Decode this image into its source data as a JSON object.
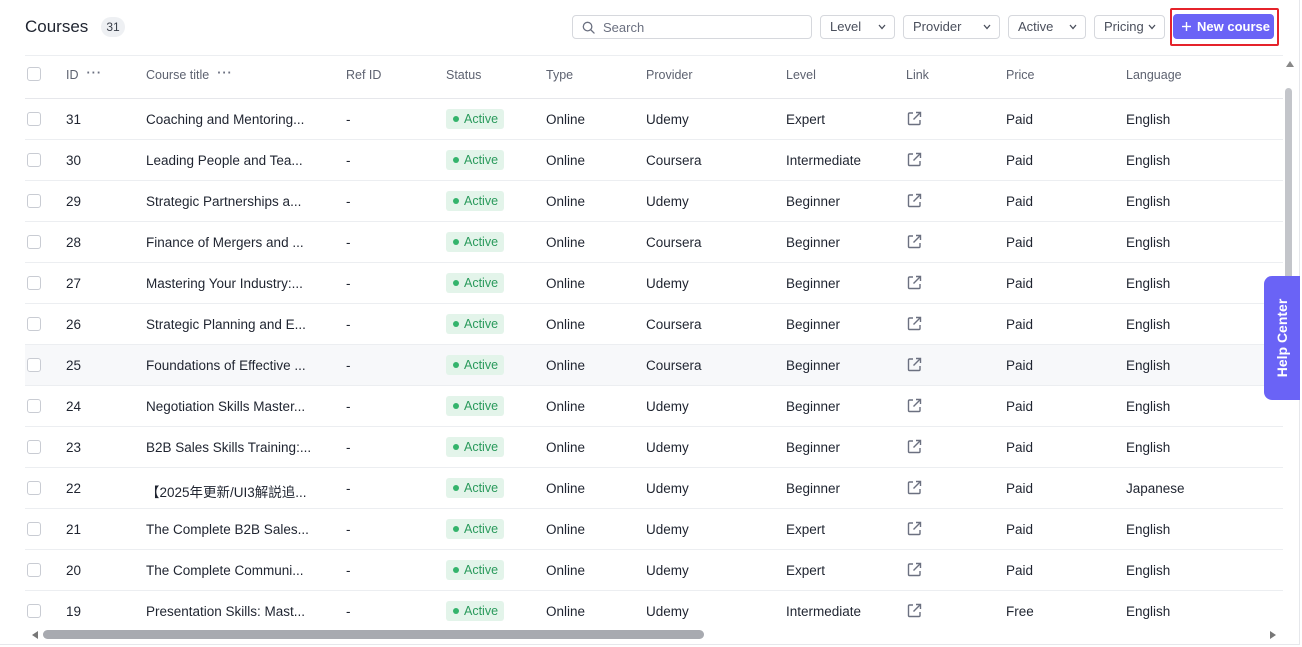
{
  "header": {
    "title": "Courses",
    "count": "31",
    "search_placeholder": "Search",
    "filters": [
      {
        "label": "Level"
      },
      {
        "label": "Provider"
      },
      {
        "label": "Active"
      },
      {
        "label": "Pricing"
      }
    ],
    "new_course_label": "New course"
  },
  "table": {
    "columns": {
      "id": "ID",
      "course_title": "Course title",
      "ref_id": "Ref ID",
      "status": "Status",
      "type": "Type",
      "provider": "Provider",
      "level": "Level",
      "link": "Link",
      "price": "Price",
      "language": "Language"
    },
    "rows": [
      {
        "id": "31",
        "title": "Coaching and Mentoring...",
        "ref": "-",
        "status": "Active",
        "type": "Online",
        "provider": "Udemy",
        "level": "Expert",
        "price": "Paid",
        "language": "English"
      },
      {
        "id": "30",
        "title": "Leading People and Tea...",
        "ref": "-",
        "status": "Active",
        "type": "Online",
        "provider": "Coursera",
        "level": "Intermediate",
        "price": "Paid",
        "language": "English"
      },
      {
        "id": "29",
        "title": "Strategic Partnerships a...",
        "ref": "-",
        "status": "Active",
        "type": "Online",
        "provider": "Udemy",
        "level": "Beginner",
        "price": "Paid",
        "language": "English"
      },
      {
        "id": "28",
        "title": "Finance of Mergers and ...",
        "ref": "-",
        "status": "Active",
        "type": "Online",
        "provider": "Coursera",
        "level": "Beginner",
        "price": "Paid",
        "language": "English"
      },
      {
        "id": "27",
        "title": "Mastering Your Industry:...",
        "ref": "-",
        "status": "Active",
        "type": "Online",
        "provider": "Udemy",
        "level": "Beginner",
        "price": "Paid",
        "language": "English"
      },
      {
        "id": "26",
        "title": "Strategic Planning and E...",
        "ref": "-",
        "status": "Active",
        "type": "Online",
        "provider": "Coursera",
        "level": "Beginner",
        "price": "Paid",
        "language": "English"
      },
      {
        "id": "25",
        "title": "Foundations of Effective ...",
        "ref": "-",
        "status": "Active",
        "type": "Online",
        "provider": "Coursera",
        "level": "Beginner",
        "price": "Paid",
        "language": "English"
      },
      {
        "id": "24",
        "title": "Negotiation Skills Master...",
        "ref": "-",
        "status": "Active",
        "type": "Online",
        "provider": "Udemy",
        "level": "Beginner",
        "price": "Paid",
        "language": "English"
      },
      {
        "id": "23",
        "title": "B2B Sales Skills Training:...",
        "ref": "-",
        "status": "Active",
        "type": "Online",
        "provider": "Udemy",
        "level": "Beginner",
        "price": "Paid",
        "language": "English"
      },
      {
        "id": "22",
        "title": "【2025年更新/UI3解説追...",
        "ref": "-",
        "status": "Active",
        "type": "Online",
        "provider": "Udemy",
        "level": "Beginner",
        "price": "Paid",
        "language": "Japanese"
      },
      {
        "id": "21",
        "title": "The Complete B2B Sales...",
        "ref": "-",
        "status": "Active",
        "type": "Online",
        "provider": "Udemy",
        "level": "Expert",
        "price": "Paid",
        "language": "English"
      },
      {
        "id": "20",
        "title": "The Complete Communi...",
        "ref": "-",
        "status": "Active",
        "type": "Online",
        "provider": "Udemy",
        "level": "Expert",
        "price": "Paid",
        "language": "English"
      },
      {
        "id": "19",
        "title": "Presentation Skills: Mast...",
        "ref": "-",
        "status": "Active",
        "type": "Online",
        "provider": "Udemy",
        "level": "Intermediate",
        "price": "Free",
        "language": "English"
      }
    ]
  },
  "help_center_label": "Help Center",
  "colors": {
    "accent": "#6a63f6",
    "highlight_outline": "#e5232b",
    "status_active_bg": "#e3f4ea",
    "status_active_text": "#2a9a5c"
  },
  "icons": {
    "search": "search-icon",
    "chevron": "chevron-down-icon",
    "plus": "plus-icon",
    "link": "external-link-icon",
    "column_menu": "more-dots-icon"
  }
}
